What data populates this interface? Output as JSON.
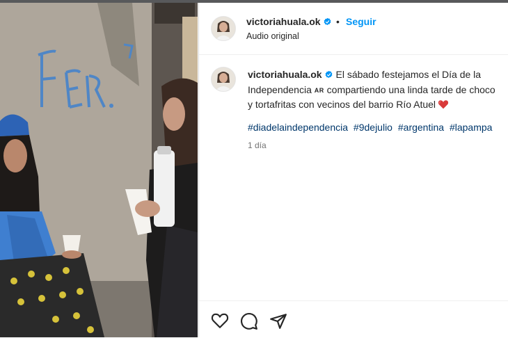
{
  "colors": {
    "accent": "#0095f6",
    "hashtag": "#00376b",
    "text": "#262626",
    "muted": "#737373",
    "verified": "#0095f6",
    "heart": "#d93a3a"
  },
  "post": {
    "image_description_icon": "photo-of-people-drinking-from-cups",
    "header": {
      "username": "victoriahuala.ok",
      "verified_icon": "verified-badge-icon",
      "separator": "•",
      "follow_label": "Seguir",
      "audio": "Audio original"
    },
    "caption": {
      "username": "victoriahuala.ok",
      "line1": "El sábado festejamos el Día de la",
      "line2_a": "Independencia",
      "flag_text": "AR",
      "line2_b": "compartiendo una linda tarde de choco",
      "line3": "y tortafritas con vecinos del barrio Río Atuel",
      "emoji_icon": "red-heart-icon"
    },
    "hashtags": [
      "#diadelaindependencia",
      "#9dejulio",
      "#argentina",
      "#lapampa"
    ],
    "time": "1 día",
    "actions": {
      "like_icon": "heart-outline-icon",
      "comment_icon": "comment-bubble-icon",
      "share_icon": "paper-plane-icon"
    }
  }
}
